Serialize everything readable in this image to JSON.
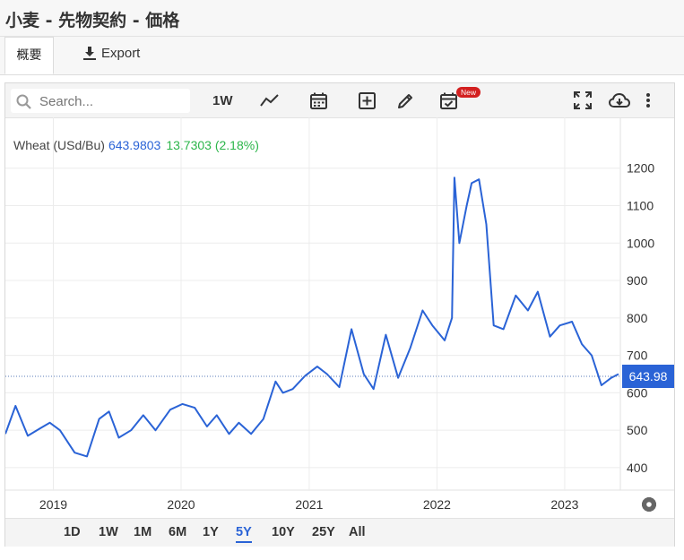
{
  "window": {
    "title": "小麦 - 先物契約 - 価格"
  },
  "tabs": {
    "overview": "概要",
    "export": "Export"
  },
  "toolbar": {
    "search_placeholder": "Search...",
    "interval": "1W",
    "new_badge": "New"
  },
  "legend": {
    "name": "Wheat (USd/Bu)",
    "price": "643.9803",
    "change": "13.7303 (2.18%)"
  },
  "ranges": [
    "1D",
    "1W",
    "1M",
    "6M",
    "1Y",
    "5Y",
    "10Y",
    "25Y",
    "All"
  ],
  "active_range": "5Y",
  "colors": {
    "line": "#2a63d6",
    "price_label_bg": "#2a63d6",
    "change_positive": "#2bb54a"
  },
  "chart_data": {
    "type": "line",
    "series": [
      {
        "name": "Wheat (USd/Bu)",
        "x": [
          "2018-08-17",
          "2018-09-15",
          "2018-10-20",
          "2018-11-24",
          "2018-12-22",
          "2019-01-20",
          "2019-03-03",
          "2019-04-07",
          "2019-05-12",
          "2019-06-09",
          "2019-07-07",
          "2019-08-11",
          "2019-09-15",
          "2019-10-20",
          "2019-12-01",
          "2020-01-05",
          "2020-02-09",
          "2020-03-15",
          "2020-04-12",
          "2020-05-17",
          "2020-06-14",
          "2020-07-19",
          "2020-08-23",
          "2020-09-27",
          "2020-10-18",
          "2020-11-15",
          "2020-12-20",
          "2021-01-24",
          "2021-02-21",
          "2021-03-28",
          "2021-05-02",
          "2021-06-06",
          "2021-07-04",
          "2021-08-08",
          "2021-09-12",
          "2021-10-17",
          "2021-11-21",
          "2021-12-19",
          "2022-01-23",
          "2022-02-13",
          "2022-02-20",
          "2022-03-06",
          "2022-03-27",
          "2022-04-10",
          "2022-05-01",
          "2022-05-22",
          "2022-06-12",
          "2022-07-10",
          "2022-08-14",
          "2022-09-18",
          "2022-10-16",
          "2022-11-20",
          "2022-12-18",
          "2023-01-22",
          "2023-02-19",
          "2023-03-19",
          "2023-04-16",
          "2023-05-14",
          "2023-06-04"
        ],
        "values": [
          490,
          565,
          485,
          505,
          520,
          500,
          440,
          430,
          530,
          550,
          480,
          500,
          540,
          500,
          555,
          570,
          560,
          510,
          540,
          490,
          520,
          490,
          530,
          630,
          600,
          610,
          645,
          670,
          650,
          615,
          770,
          650,
          610,
          755,
          640,
          720,
          820,
          780,
          740,
          800,
          1175,
          1000,
          1100,
          1160,
          1170,
          1050,
          780,
          770,
          860,
          820,
          870,
          750,
          780,
          790,
          730,
          700,
          620,
          640,
          650
        ]
      }
    ],
    "x_ticks": [
      "2019",
      "2020",
      "2021",
      "2022",
      "2023"
    ],
    "y_ticks": [
      "400",
      "500",
      "600",
      "700",
      "800",
      "900",
      "1000",
      "1100",
      "1200"
    ],
    "ylim": [
      340,
      1240
    ],
    "last_price_label": "643.98",
    "grid": true,
    "y_axis_side": "right"
  }
}
